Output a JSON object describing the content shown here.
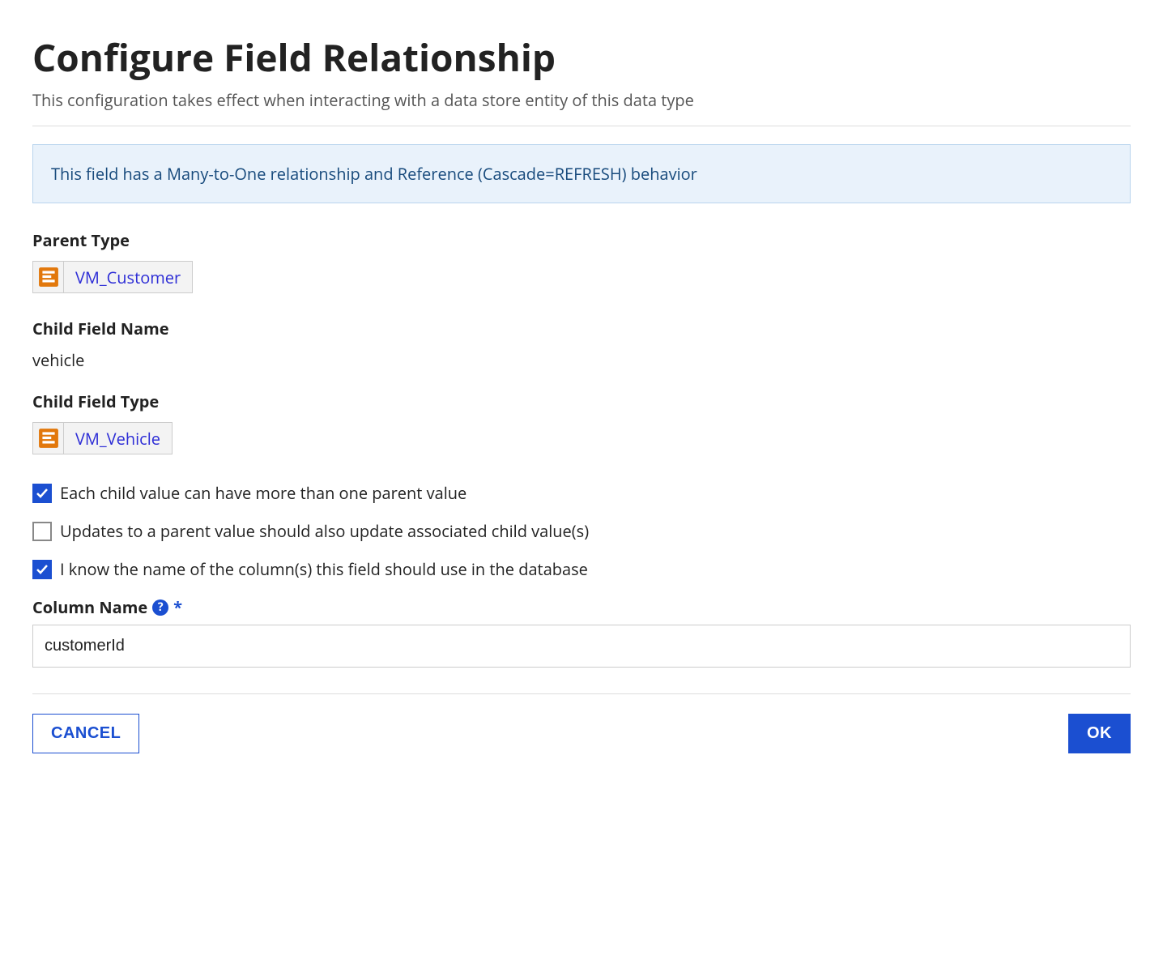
{
  "header": {
    "title": "Configure Field Relationship",
    "subtitle": "This configuration takes effect when interacting with a data store entity of this data type"
  },
  "banner": {
    "text": "This field has a Many-to-One relationship and Reference (Cascade=REFRESH) behavior"
  },
  "parent_type": {
    "label": "Parent Type",
    "value": "VM_Customer"
  },
  "child_field_name": {
    "label": "Child Field Name",
    "value": "vehicle"
  },
  "child_field_type": {
    "label": "Child Field Type",
    "value": "VM_Vehicle"
  },
  "checkboxes": {
    "multi_parent": {
      "label": "Each child value can have more than one parent value",
      "checked": true
    },
    "cascade_update": {
      "label": "Updates to a parent value should also update associated child value(s)",
      "checked": false
    },
    "know_column": {
      "label": "I know the name of the column(s) this field should use in the database",
      "checked": true
    }
  },
  "column_name": {
    "label": "Column Name",
    "value": "customerId"
  },
  "buttons": {
    "cancel": "CANCEL",
    "ok": "OK"
  },
  "glyphs": {
    "help": "?"
  }
}
